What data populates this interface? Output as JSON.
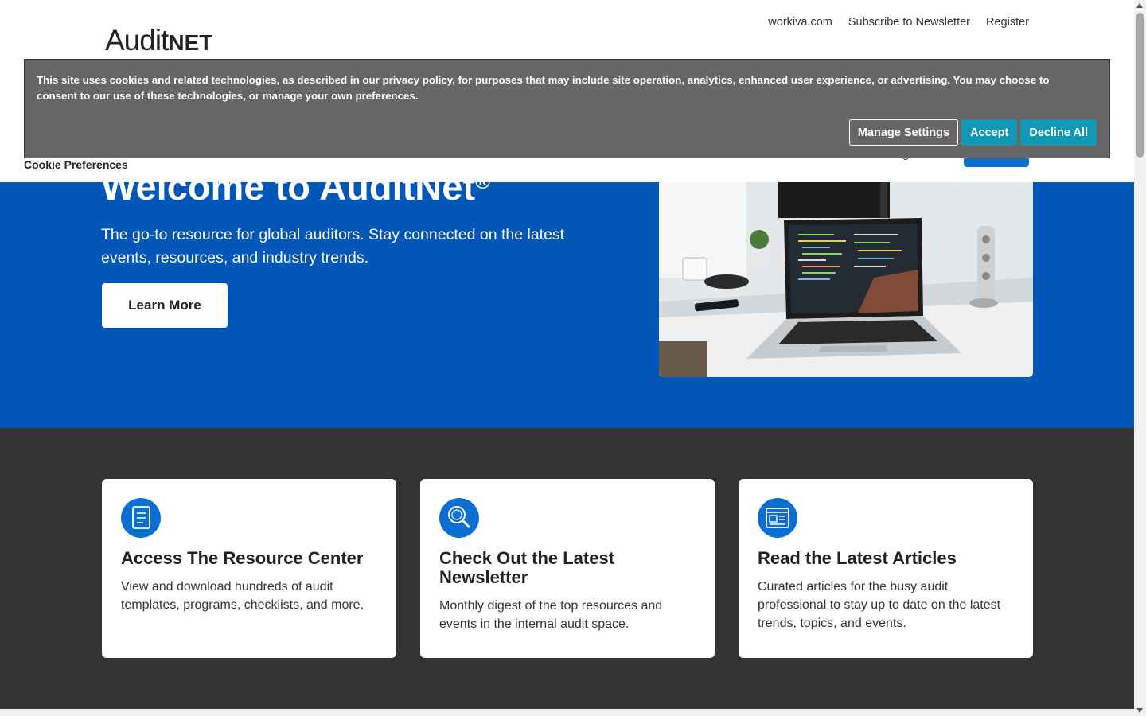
{
  "header": {
    "logo_main": "Audit",
    "logo_suffix": "NET",
    "top_links": [
      "workiva.com",
      "Subscribe to Newsletter",
      "Register"
    ],
    "nav_partial": "g",
    "cookie_preferences_label": "Cookie Preferences"
  },
  "cookie_banner": {
    "text": "This site uses cookies and related technologies, as described in our privacy policy, for purposes that may include site operation, analytics, enhanced user experience, or advertising. You may choose to consent to our use of these technologies, or manage your own preferences.",
    "manage_label": "Manage Settings",
    "accept_label": "Accept",
    "decline_label": "Decline All"
  },
  "hero": {
    "title": "Welcome to AuditNet",
    "registered_mark": "®",
    "subtitle": "The go-to resource for global auditors. Stay connected on the latest events, resources, and industry trends.",
    "button_label": "Learn More"
  },
  "cards": [
    {
      "icon": "document-icon",
      "title": "Access The Resource Center",
      "text": "View and download hundreds of audit templates, programs, checklists, and more."
    },
    {
      "icon": "magnifier-icon",
      "title": "Check Out the Latest Newsletter",
      "text": "Monthly digest of the top resources and events in the internal audit space."
    },
    {
      "icon": "newspaper-icon",
      "title": "Read the Latest Articles",
      "text": "Curated articles for the busy audit professional to stay up to date on the latest trends, topics, and events."
    }
  ],
  "colors": {
    "hero_blue": "#0057b8",
    "card_section": "#333333",
    "icon_blue": "#0a6fd1",
    "banner_gray": "#666666",
    "cookie_accent": "#1098b5"
  }
}
